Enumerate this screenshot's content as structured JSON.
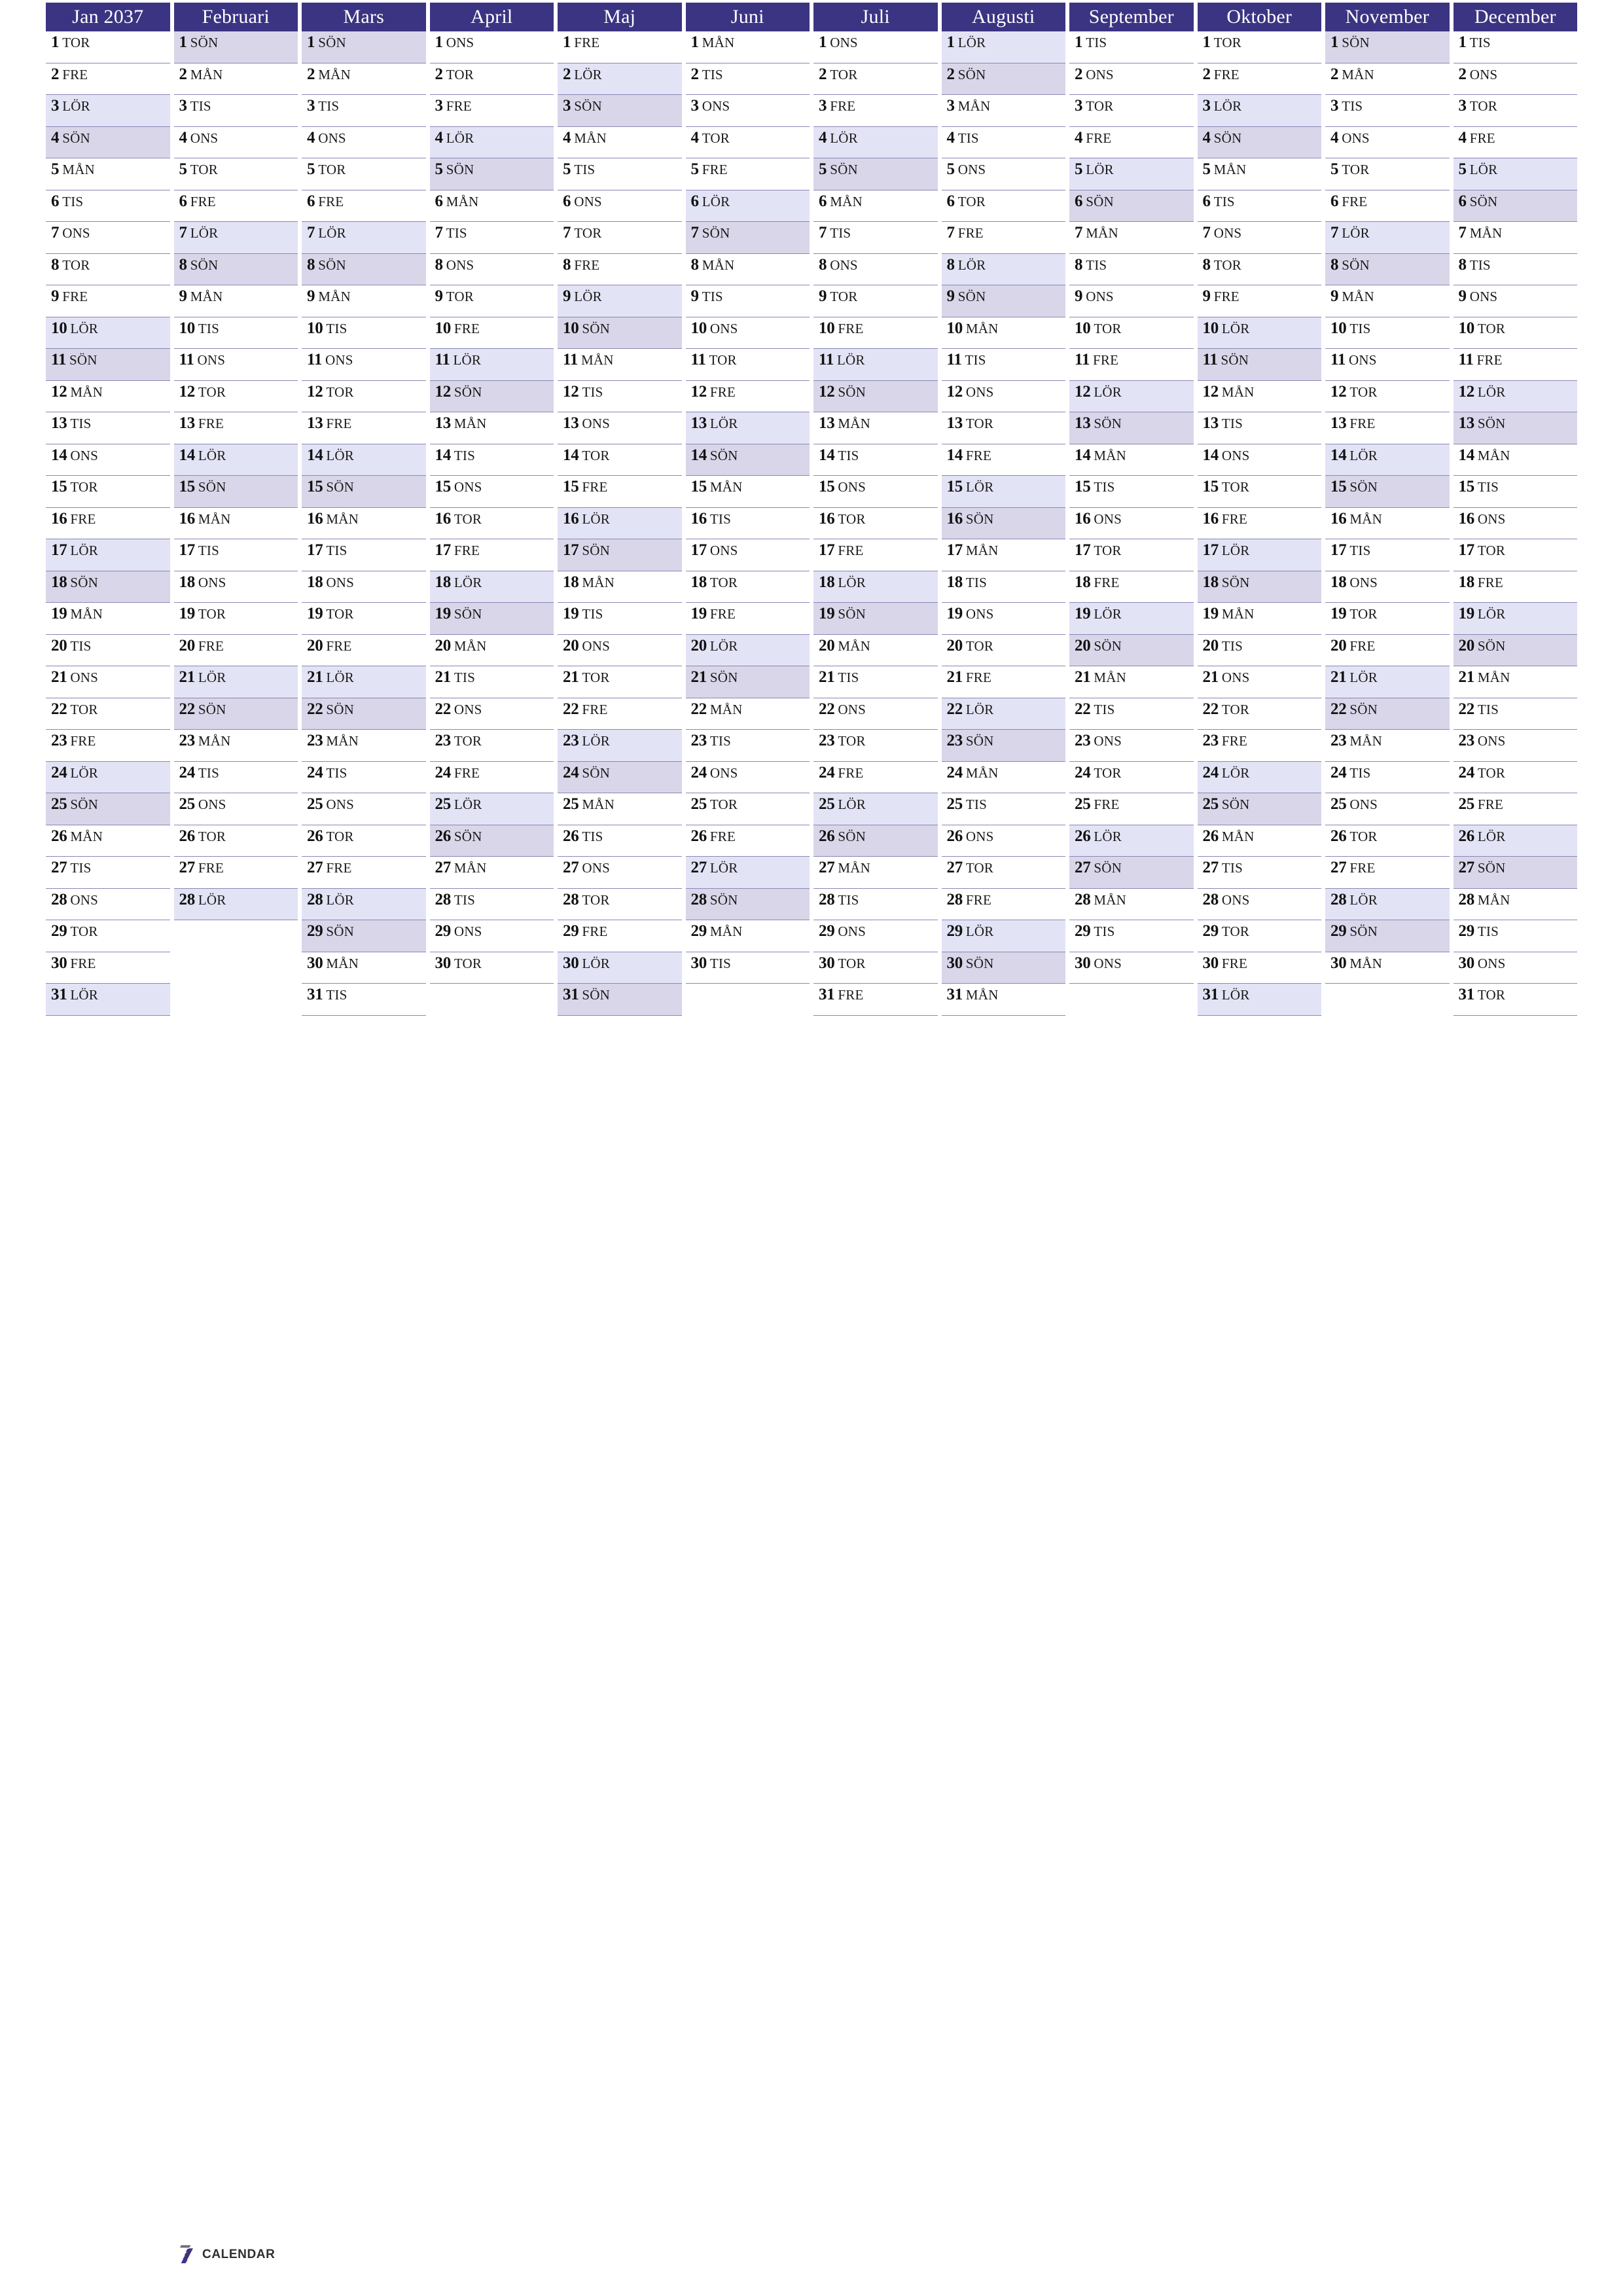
{
  "document": {
    "type": "year-planner",
    "year": "2037",
    "locale": "sv",
    "page_size": "A4-portrait"
  },
  "colors": {
    "header_bg": "#3b3483",
    "header_text": "#ffffff",
    "saturday_bg": "#e3e3f6",
    "sunday_bg": "#d9d6e9",
    "rule": "#8a86b5",
    "page_bg": "#ffffff",
    "logo_accent": "#3b3483",
    "logo_text": "#2e2e33"
  },
  "logo": {
    "mark": "seven-stripes-icon",
    "text": "CALENDAR"
  },
  "weekday_labels": {
    "1": "MÅN",
    "2": "TIS",
    "3": "ONS",
    "4": "TOR",
    "5": "FRE",
    "6": "LÖR",
    "7": "SÖN"
  },
  "day_row_numbers": [
    1,
    2,
    3,
    4,
    5,
    6,
    7,
    8,
    9,
    10,
    11,
    12,
    13,
    14,
    15,
    16,
    17,
    18,
    19,
    20,
    21,
    22,
    23,
    24,
    25,
    26,
    27,
    28,
    29,
    30,
    31
  ],
  "months": [
    {
      "index": 1,
      "label": "Jan 2037",
      "days": 31,
      "first_weekday": 4
    },
    {
      "index": 2,
      "label": "Februari",
      "days": 28,
      "first_weekday": 7
    },
    {
      "index": 3,
      "label": "Mars",
      "days": 31,
      "first_weekday": 7
    },
    {
      "index": 4,
      "label": "April",
      "days": 30,
      "first_weekday": 3
    },
    {
      "index": 5,
      "label": "Maj",
      "days": 31,
      "first_weekday": 5
    },
    {
      "index": 6,
      "label": "Juni",
      "days": 30,
      "first_weekday": 1
    },
    {
      "index": 7,
      "label": "Juli",
      "days": 31,
      "first_weekday": 3
    },
    {
      "index": 8,
      "label": "Augusti",
      "days": 31,
      "first_weekday": 6
    },
    {
      "index": 9,
      "label": "September",
      "days": 30,
      "first_weekday": 2
    },
    {
      "index": 10,
      "label": "Oktober",
      "days": 31,
      "first_weekday": 4
    },
    {
      "index": 11,
      "label": "November",
      "days": 30,
      "first_weekday": 7
    },
    {
      "index": 12,
      "label": "December",
      "days": 31,
      "first_weekday": 2
    }
  ]
}
